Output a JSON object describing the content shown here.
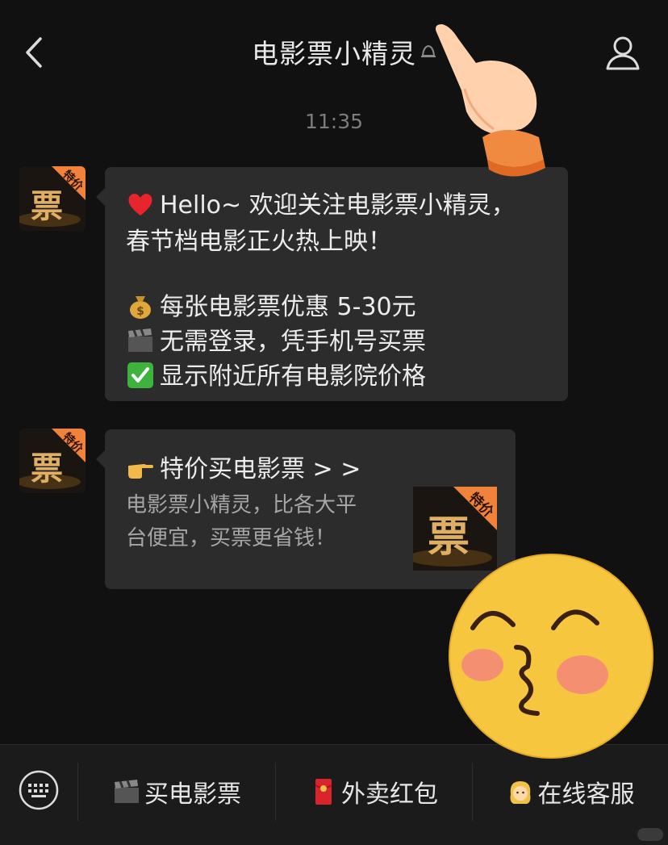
{
  "header": {
    "title": "电影票小精灵"
  },
  "chat": {
    "time": "11:35",
    "message1": {
      "lines": [
        "Hello~ 欢迎关注电影票小精灵，",
        "春节档电影正火热上映！",
        "每张电影票优惠 5-30元",
        "无需登录，凭手机号买票",
        "显示附近所有电影院价格"
      ]
    },
    "message2": {
      "title": "特价买电影票 > >",
      "desc_line1": "电影票小精灵，比各大平",
      "desc_line2": "台便宜，买票更省钱！"
    },
    "avatar_badge": "特价",
    "avatar_char": "票"
  },
  "bottom_menu": {
    "items": [
      {
        "label": "买电影票",
        "icon": "clapperboard-icon"
      },
      {
        "label": "外卖红包",
        "icon": "red-envelope-icon"
      },
      {
        "label": "在线客服",
        "icon": "person-icon"
      }
    ]
  },
  "colors": {
    "background": "#111111",
    "bubble": "#2c2c2c",
    "bottom_bar": "#1b1b1b",
    "badge_orange": "#f0823a",
    "gold": "#d9a43c"
  }
}
